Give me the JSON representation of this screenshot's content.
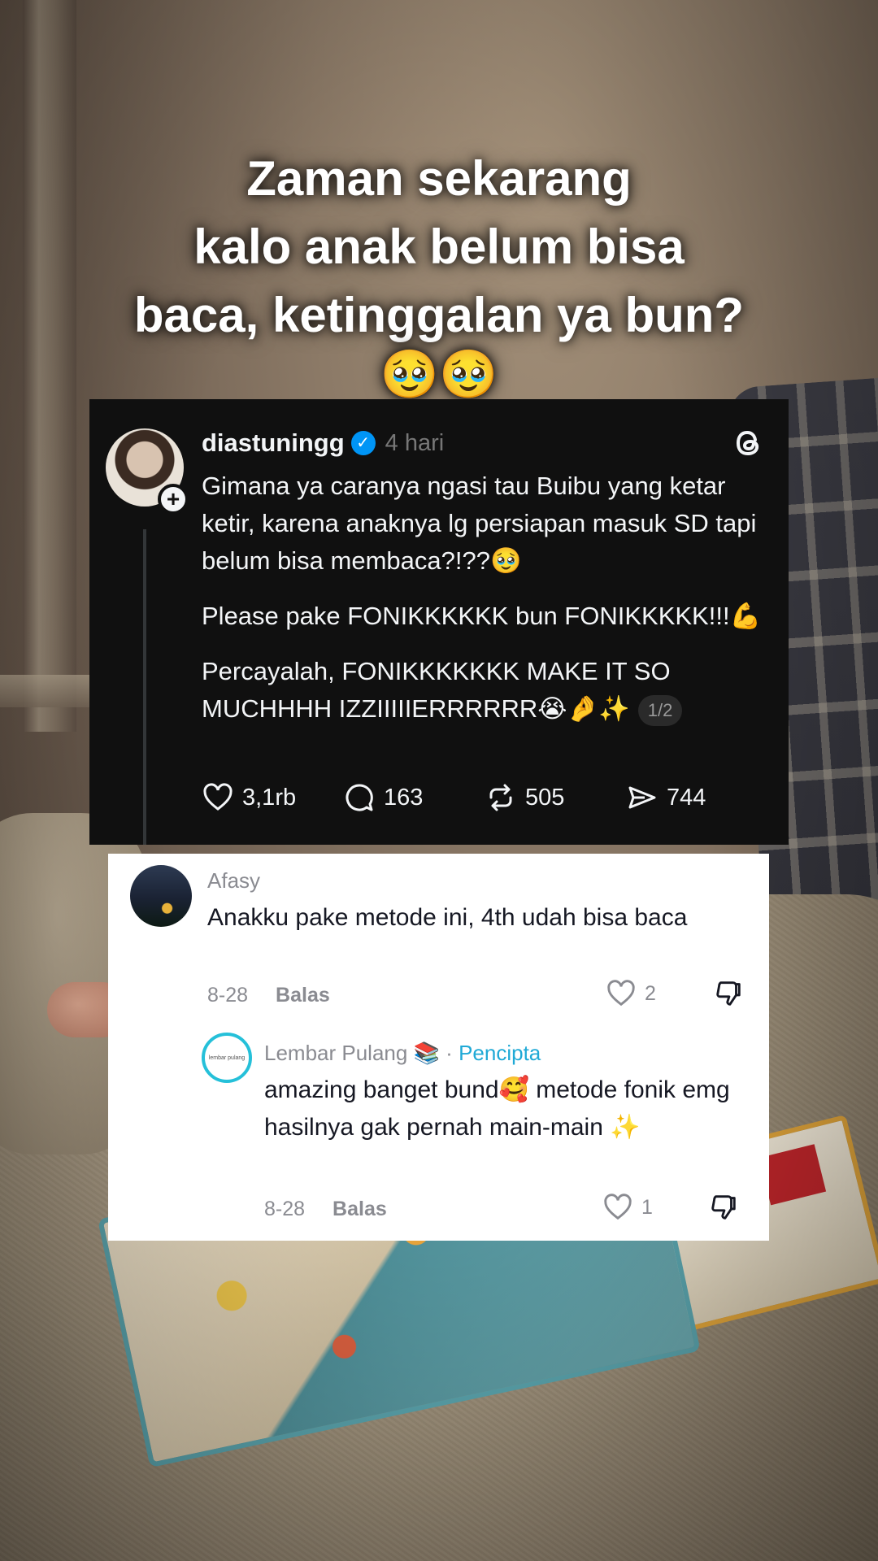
{
  "caption": {
    "line1": "Zaman sekarang",
    "line2": "kalo anak belum bisa",
    "line3": "baca, ketinggalan ya bun?",
    "emojis": "🥹🥹"
  },
  "threads_post": {
    "username": "diastuningg",
    "time": "4 hari",
    "paragraph1": "Gimana ya caranya ngasi tau Buibu yang ketar ketir, karena anaknya lg persiapan masuk SD tapi belum bisa membaca?!??🥹",
    "paragraph2": "Please pake FONIKKKKKK bun FONIKKKKK!!!💪",
    "paragraph3": "Percayalah, FONIKKKKKKK MAKE IT SO MUCHHHH IZZIIIIIERRRRRR😭🤌✨",
    "page_indicator": "1/2",
    "likes": "3,1rb",
    "replies": "163",
    "reposts": "505",
    "shares": "744"
  },
  "comment": {
    "author": "Afasy",
    "text": "Anakku pake metode ini, 4th udah bisa baca",
    "date": "8-28",
    "reply_label": "Balas",
    "likes": "2"
  },
  "reply": {
    "author": "Lembar Pulang 📚",
    "separator": "·",
    "badge": "Pencipta",
    "avatar_text": "lembar pulang",
    "text": "amazing banget bund🥰 metode fonik emg hasilnya gak pernah main-main ✨",
    "date": "8-28",
    "reply_label": "Balas",
    "likes": "1"
  },
  "colors": {
    "threads_bg": "#101010",
    "verified_blue": "#0095f6",
    "creator_blue": "#1fa9d6",
    "comment_bg": "#ffffff"
  }
}
